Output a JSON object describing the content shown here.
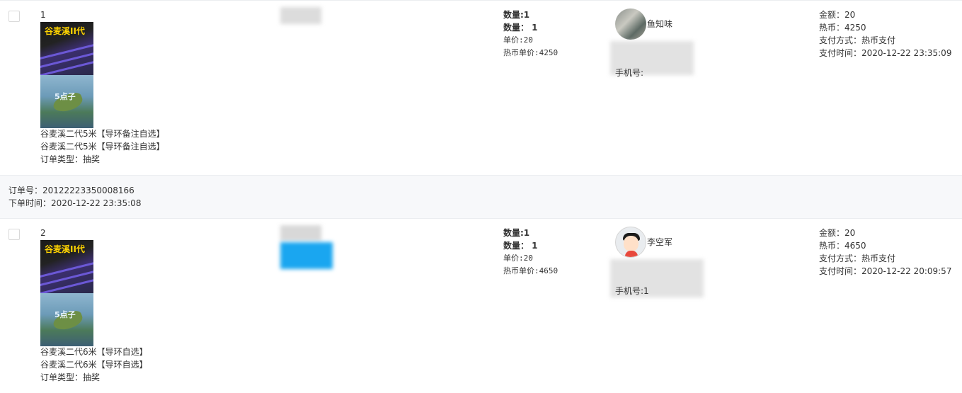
{
  "orders": [
    {
      "index": "1",
      "product_lines": [
        "谷麦溪二代5米【导环备注自选】",
        "谷麦溪二代5米【导环备注自选】"
      ],
      "order_type": "订单类型：抽奖",
      "image_text_a": "谷麦溪II代",
      "image_text_b": "5点子",
      "qty_a": "数量:1",
      "qty_b": "数量： 1",
      "unit_price": "单价:20",
      "coin_unit_price": "热币单价:4250",
      "user_name": "鱼知味",
      "phone_label": "手机号:",
      "amount": "金额：20",
      "coins": "热币：4250",
      "pay_method": "支付方式：热币支付",
      "pay_time": "支付时间：2020-12-22 23:35:09"
    },
    {
      "index": "2",
      "product_lines": [
        "谷麦溪二代6米【导环自选】",
        "谷麦溪二代6米【导环自选】"
      ],
      "order_type": "订单类型：抽奖",
      "image_text_a": "谷麦溪II代",
      "image_text_b": "5点子",
      "qty_a": "数量:1",
      "qty_b": "数量： 1",
      "unit_price": "单价:20",
      "coin_unit_price": "热币单价:4650",
      "user_name": "李空军",
      "phone_label": "手机号:1",
      "amount": "金额：20",
      "coins": "热币：4650",
      "pay_method": "支付方式：热币支付",
      "pay_time": "支付时间：2020-12-22 20:09:57"
    }
  ],
  "order_meta": {
    "order_no": "订单号：20122223350008166",
    "order_time": "下单时间：2020-12-22 23:35:08"
  },
  "colors": {
    "text": "#333333",
    "border": "#ebedf0",
    "meta_bg": "#f7f8fa",
    "blur_blue": "#1aa6f0"
  },
  "icons": [
    "checkbox",
    "product-thumbnail",
    "user-avatar"
  ]
}
